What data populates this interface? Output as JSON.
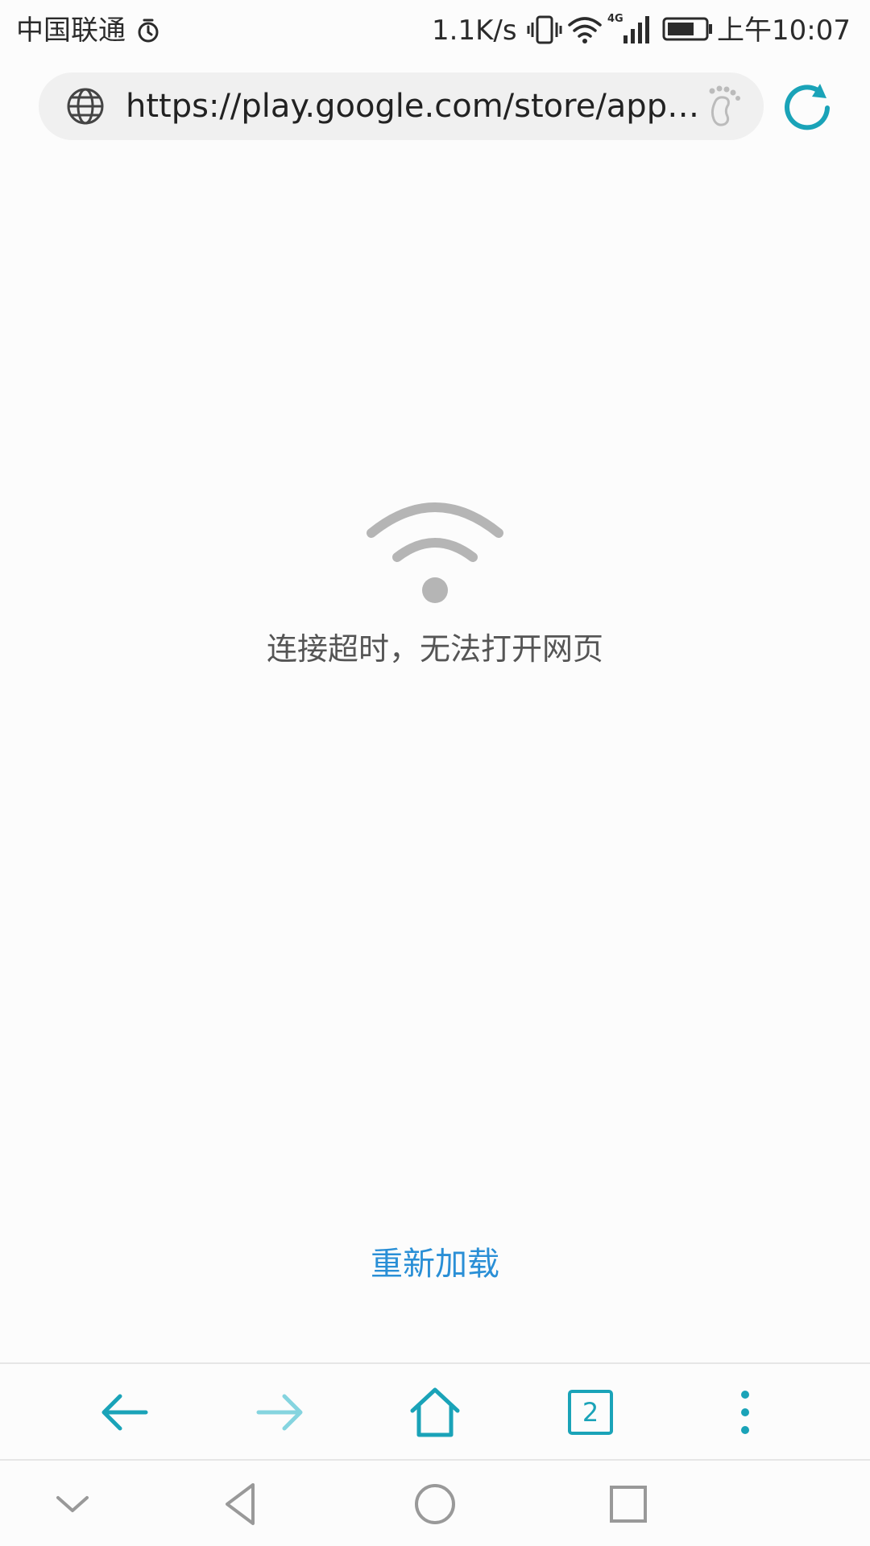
{
  "status_bar": {
    "carrier": "中国联通",
    "net_speed": "1.1K/s",
    "clock": "上午10:07",
    "icons": [
      "alarm-icon",
      "vibrate-icon",
      "wifi-icon",
      "signal-4g-icon",
      "battery-icon"
    ]
  },
  "address_bar": {
    "url": "https://play.google.com/store/apps/...",
    "icons": [
      "globe-icon",
      "footprint-icon",
      "reload-icon"
    ],
    "accent_color": "#1aa3b8"
  },
  "error_page": {
    "icon": "wifi-icon",
    "message": "连接超时，无法打开网页",
    "reload_label": "重新加载",
    "link_color": "#2a8fd6"
  },
  "toolbar": {
    "tab_count": "2",
    "icons": [
      "back-arrow-icon",
      "forward-arrow-icon",
      "home-icon",
      "tabs-icon",
      "more-icon"
    ]
  },
  "system_nav": {
    "icons": [
      "chevron-down-icon",
      "back-triangle-icon",
      "home-circle-icon",
      "recents-square-icon"
    ]
  }
}
